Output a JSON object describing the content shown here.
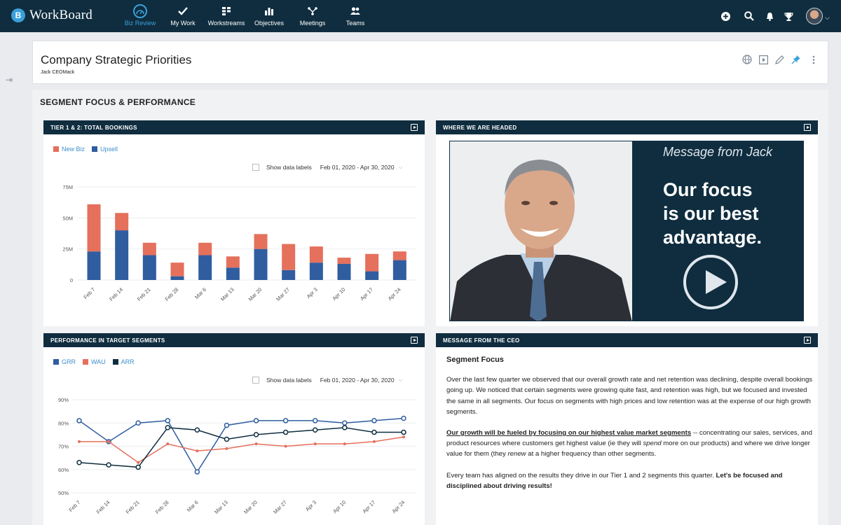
{
  "app": {
    "name": "WorkBoard",
    "logo_letter": "B"
  },
  "nav": {
    "items": [
      {
        "label": "Biz Review",
        "icon": "gauge-icon",
        "active": true
      },
      {
        "label": "My Work",
        "icon": "check-icon",
        "active": false
      },
      {
        "label": "Workstreams",
        "icon": "workstreams-icon",
        "active": false
      },
      {
        "label": "Objectives",
        "icon": "bar-chart-icon",
        "active": false
      },
      {
        "label": "Meetings",
        "icon": "meetings-icon",
        "active": false
      },
      {
        "label": "Teams",
        "icon": "teams-icon",
        "active": false
      }
    ],
    "right_icons": [
      "add-icon",
      "search-icon",
      "bell-icon",
      "trophy-icon"
    ]
  },
  "page": {
    "title": "Company Strategic Priorities",
    "owner": "Jack CEOMack",
    "header_icons": [
      "globe-icon",
      "present-icon",
      "edit-icon",
      "pin-icon",
      "more-icon"
    ]
  },
  "section": {
    "title": "SEGMENT FOCUS & PERFORMANCE"
  },
  "panels": {
    "bookings": {
      "title": "TIER 1 & 2: TOTAL BOOKINGS",
      "legend": [
        "New Biz",
        "Upsell"
      ],
      "show_labels": "Show data labels",
      "date_range": "Feb 01, 2020 - Apr 30, 2020"
    },
    "headed": {
      "title": "WHERE WE ARE HEADED",
      "video_caption": "Message from Jack",
      "video_headline_1": "Our focus",
      "video_headline_2": "is our best",
      "video_headline_3": "advantage."
    },
    "performance": {
      "title": "PERFORMANCE IN TARGET SEGMENTS",
      "legend": [
        "GRR",
        "WAU",
        "ARR"
      ],
      "show_labels": "Show data labels",
      "date_range": "Feb 01, 2020 - Apr 30, 2020"
    },
    "ceo": {
      "title": "MESSAGE FROM THE CEO",
      "heading": "Segment Focus",
      "p1": "Over the last few quarter we observed that our overall growth rate and net retention was declining, despite overall bookings going up. We noticed that certain segments were growing quite fast, and retention was high, but we focused and invested the same in all segments. Our focus on segments with high prices and low retention was at the expense of our high growth segments.",
      "p2_link": "Our growth will be fueled by focusing on our highest value market segments",
      "p2_a": " -- concentrating our sales, services, and product resources where customers get highest value (ie they will ",
      "p2_em1": "spend",
      "p2_b": " more on our products) and where we drive longer value for them (they ",
      "p2_em2": "renew",
      "p2_c": " at a higher frequency than other segments.",
      "p3_a": "Every team has aligned on the results they drive in our Tier 1 and 2 segments this quarter. ",
      "p3_bold": "Let's be focused and disciplined about driving results!"
    }
  },
  "colors": {
    "navy": "#0f2d3f",
    "accent": "#3aa0da",
    "new_biz": "#e5705c",
    "upsell": "#2f5da0",
    "grr": "#2f5da0",
    "wau": "#e5705c",
    "arr": "#0f2d3f"
  },
  "chart_data": [
    {
      "type": "bar",
      "stacked": true,
      "categories": [
        "Feb 7",
        "Feb 14",
        "Feb 21",
        "Feb 28",
        "Mar 6",
        "Mar 13",
        "Mar 20",
        "Mar 27",
        "Apr 3",
        "Apr 10",
        "Apr 17",
        "Apr 24"
      ],
      "series": [
        {
          "name": "Upsell",
          "values": [
            23,
            40,
            20,
            3,
            20,
            10,
            25,
            8,
            14,
            13,
            7,
            16
          ]
        },
        {
          "name": "New Biz",
          "values": [
            38,
            14,
            10,
            11,
            10,
            9,
            12,
            21,
            13,
            5,
            14,
            7
          ]
        }
      ],
      "y_ticks": [
        "0",
        "25M",
        "50M",
        "75M"
      ],
      "ylim": [
        0,
        75
      ],
      "legend_position": "top-left"
    },
    {
      "type": "line",
      "categories": [
        "Feb 7",
        "Feb 14",
        "Feb 21",
        "Feb 28",
        "Mar 6",
        "Mar 13",
        "Mar 20",
        "Mar 27",
        "Apr 3",
        "Apr 10",
        "Apr 17",
        "Apr 24"
      ],
      "series": [
        {
          "name": "GRR",
          "values": [
            81,
            72,
            80,
            81,
            59,
            79,
            81,
            81,
            81,
            80,
            81,
            82
          ]
        },
        {
          "name": "WAU",
          "values": [
            72,
            72,
            63,
            71,
            68,
            69,
            71,
            70,
            71,
            71,
            72,
            74
          ]
        },
        {
          "name": "ARR",
          "values": [
            63,
            62,
            61,
            78,
            77,
            73,
            75,
            76,
            77,
            78,
            76,
            76
          ]
        }
      ],
      "y_ticks": [
        "50%",
        "60%",
        "70%",
        "80%",
        "90%"
      ],
      "ylim": [
        50,
        90
      ],
      "legend_position": "top-left"
    }
  ]
}
